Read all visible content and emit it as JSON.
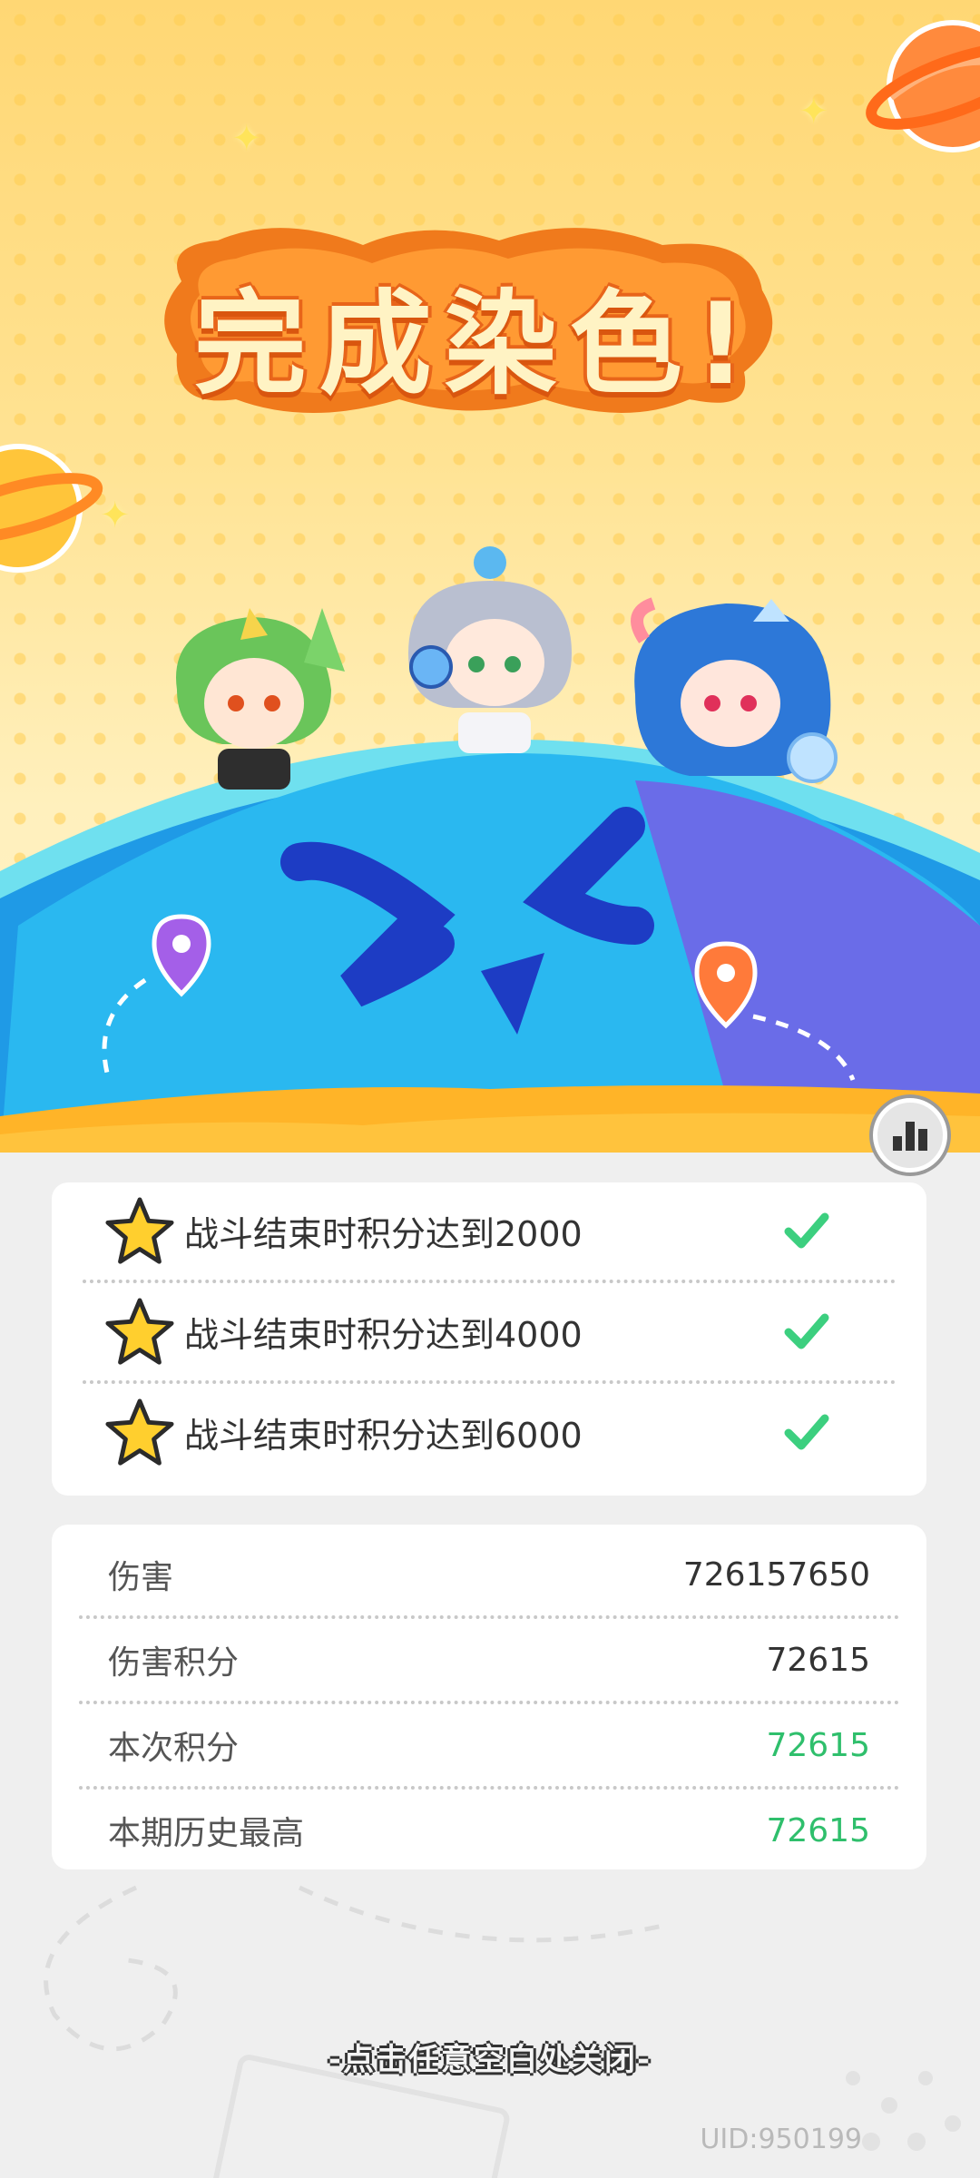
{
  "title": "完成染色!",
  "goals": [
    {
      "text": "战斗结束时积分达到2000",
      "done": true
    },
    {
      "text": "战斗结束时积分达到4000",
      "done": true
    },
    {
      "text": "战斗结束时积分达到6000",
      "done": true
    }
  ],
  "stats": [
    {
      "label": "伤害",
      "value": "726157650",
      "highlight": false
    },
    {
      "label": "伤害积分",
      "value": "72615",
      "highlight": false
    },
    {
      "label": "本次积分",
      "value": "72615",
      "highlight": true
    },
    {
      "label": "本期历史最高",
      "value": "72615",
      "highlight": true
    }
  ],
  "close_hint": "-点击任意空白处关闭-",
  "uid": "UID:950199",
  "colors": {
    "orange": "#f07a1c",
    "green_value": "#2fbf6c",
    "globe_blue": "#2aa7ec",
    "check_green": "#3ccf7f"
  },
  "icons": [
    "star-icon",
    "check-icon",
    "leaderboard-icon",
    "planet-icon",
    "map-pin-icon"
  ]
}
